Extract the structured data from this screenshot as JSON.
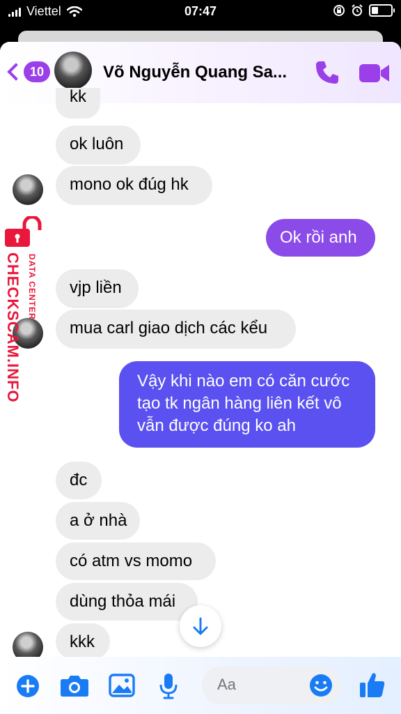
{
  "status_bar": {
    "carrier": "Viettel",
    "time": "07:47"
  },
  "colors": {
    "accent": "#9b3fe8",
    "blue": "#1a7cf5",
    "outgoing_purple": "#8a4be8",
    "outgoing_blue": "#5a51f0",
    "incoming_bg": "#ececec",
    "watermark": "#e8173b"
  },
  "header": {
    "back_count": "10",
    "contact_name": "Võ Nguyễn Quang Sa...",
    "icons": [
      "chevron-left-icon",
      "phone-icon",
      "video-camera-icon"
    ]
  },
  "messages": [
    {
      "side": "in",
      "text": "kk"
    },
    {
      "side": "in",
      "text": "ok luôn"
    },
    {
      "side": "in",
      "text": "mono ok đúg hk"
    },
    {
      "side": "out",
      "text": "Ok rồi anh"
    },
    {
      "side": "in",
      "text": "vjp liền"
    },
    {
      "side": "in",
      "text": "mua carl giao dịch các kểu"
    },
    {
      "side": "out",
      "lines": [
        "Vậy khi nào em có căn cước",
        "tạo tk ngân hàng liên kết vô",
        "vẫn được đúng ko ah"
      ]
    },
    {
      "side": "in",
      "text": "đc"
    },
    {
      "side": "in",
      "text": "a ở nhà"
    },
    {
      "side": "in",
      "text": "có atm vs momo"
    },
    {
      "side": "in",
      "text": "dùng thỏa mái"
    },
    {
      "side": "in",
      "text": "kkk"
    }
  ],
  "watermark": {
    "main": "CHECKSCAM.INFO",
    "sub": "DATA CENTER"
  },
  "composer": {
    "placeholder": "Aa",
    "icons": [
      "plus-icon",
      "camera-icon",
      "image-icon",
      "microphone-icon",
      "emoji-icon",
      "thumbs-up-icon"
    ]
  }
}
